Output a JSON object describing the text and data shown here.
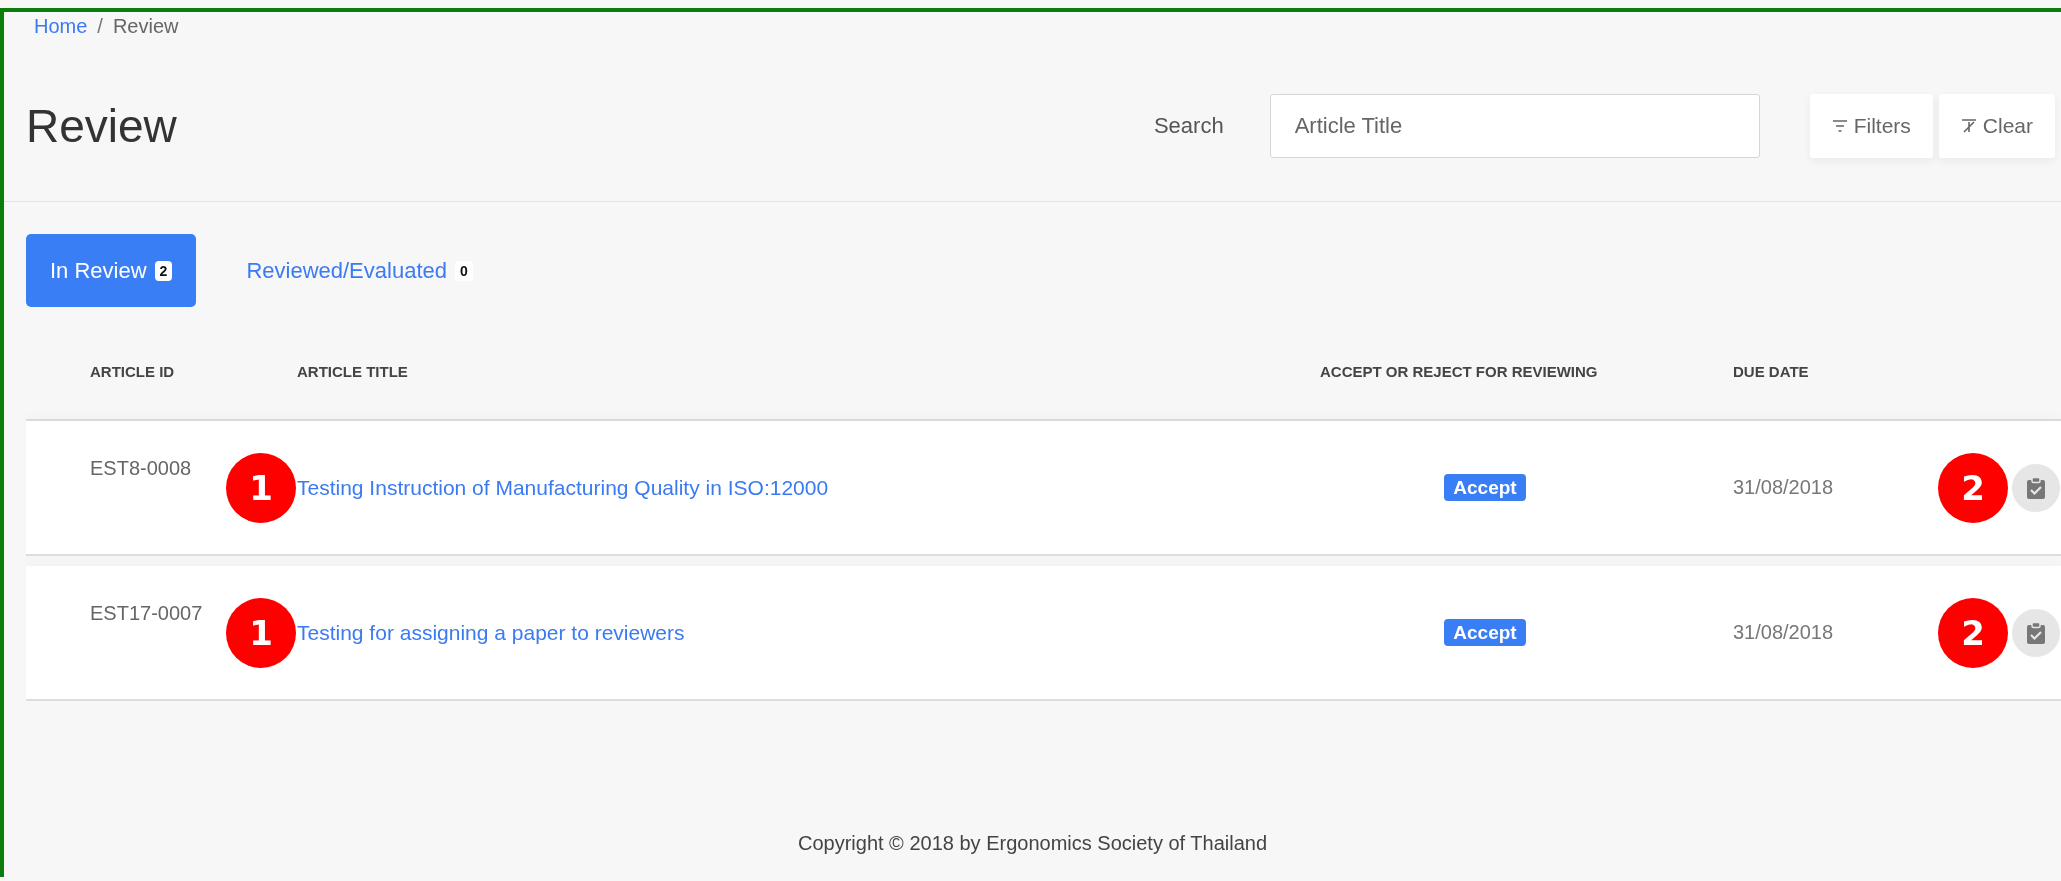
{
  "breadcrumb": [
    {
      "label": "Home",
      "link": true
    },
    {
      "label": "Review",
      "link": false
    }
  ],
  "breadcrumb_separator": "/",
  "page_title": "Review",
  "search": {
    "label": "Search",
    "placeholder": "Article Title"
  },
  "buttons": [
    {
      "label": "Filters",
      "kind": "filter"
    },
    {
      "label": "Clear",
      "kind": "clear"
    }
  ],
  "tabs": [
    {
      "label": "In Review",
      "count": "2",
      "selected": true
    },
    {
      "label": "Reviewed/Evaluated",
      "count": "0",
      "selected": false
    }
  ],
  "table": {
    "columns": [
      "ARTICLE ID",
      "ARTICLE TITLE",
      "ACCEPT OR REJECT FOR REVIEWING",
      "DUE DATE"
    ],
    "rows": [
      {
        "article_id": "EST8-0008",
        "title": "Testing Instruction of Manufacturing Quality in ISO:12000",
        "status": "Accept",
        "due_date": "31/08/2018",
        "markers": [
          "1",
          "2"
        ]
      },
      {
        "article_id": "EST17-0007",
        "title": "Testing for assigning a paper to reviewers",
        "status": "Accept",
        "due_date": "31/08/2018",
        "markers": [
          "1",
          "2"
        ]
      }
    ]
  },
  "footer": "Copyright © 2018 by Ergonomics Society of Thailand"
}
